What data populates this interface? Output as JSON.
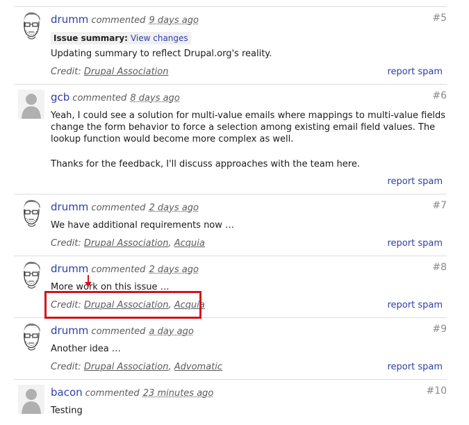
{
  "comments": [
    {
      "number": "#5",
      "author": "drumm",
      "verb": "commented",
      "time": "9 days ago",
      "avatar": "drumm-sketch-avatar",
      "issue_summary": {
        "label": "Issue summary:",
        "link": "View changes"
      },
      "text": "Updating summary to reflect Drupal.org's reality.",
      "credit_label": "Credit:",
      "credits": [
        "Drupal Association"
      ],
      "report": "report spam"
    },
    {
      "number": "#6",
      "author": "gcb",
      "verb": "commented",
      "time": "8 days ago",
      "avatar": "default-user-avatar",
      "text_lines": [
        "Yeah, I could see a solution for multi-value emails where mappings to multi-value fields",
        "change the form behavior to force a selection among existing email field values. The",
        "lookup function would become more complex as well.",
        "",
        "Thanks for the feedback, I'll discuss approaches with the team here."
      ],
      "report": "report spam"
    },
    {
      "number": "#7",
      "author": "drumm",
      "verb": "commented",
      "time": "2 days ago",
      "avatar": "drumm-sketch-avatar",
      "text": "We have additional requirements now …",
      "credit_label": "Credit:",
      "credits": [
        "Drupal Association",
        "Acquia"
      ],
      "report": "report spam"
    },
    {
      "number": "#8",
      "author": "drumm",
      "verb": "commented",
      "time": "2 days ago",
      "avatar": "drumm-sketch-avatar",
      "text": "More work on this issue …",
      "credit_label": "Credit:",
      "credits": [
        "Drupal Association",
        "Acquia"
      ],
      "report": "report spam"
    },
    {
      "number": "#9",
      "author": "drumm",
      "verb": "commented",
      "time": "a day ago",
      "avatar": "drumm-sketch-avatar",
      "text": "Another idea …",
      "credit_label": "Credit:",
      "credits": [
        "Drupal Association",
        "Advomatic"
      ],
      "report": "report spam"
    },
    {
      "number": "#10",
      "author": "bacon",
      "verb": "commented",
      "time": "23 minutes ago",
      "avatar": "default-user-avatar",
      "text": "Testing"
    }
  ],
  "colors": {
    "link": "#2d3fa6",
    "annotation": "#d3121c",
    "separator": "#dcdcdc"
  }
}
